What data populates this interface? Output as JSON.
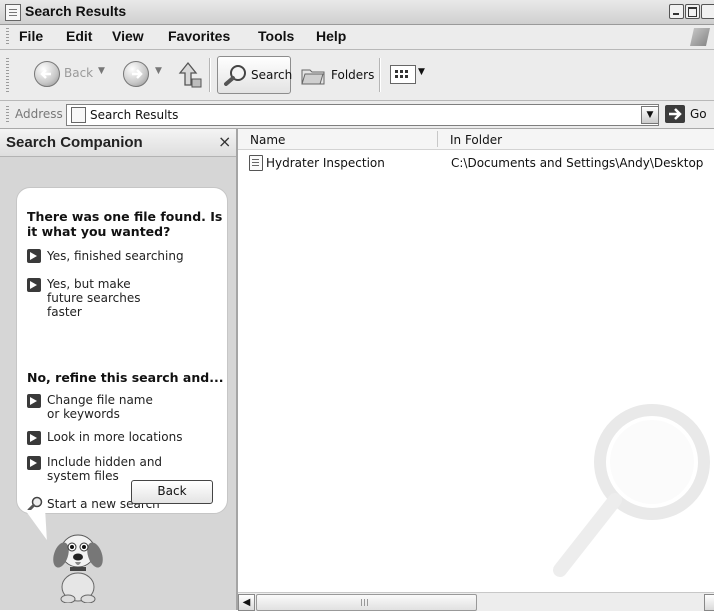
{
  "window": {
    "title": "Search Results"
  },
  "menu": {
    "items": [
      "File",
      "Edit",
      "View",
      "Favorites",
      "Tools",
      "Help"
    ]
  },
  "toolbar": {
    "back_label": "Back",
    "search_label": "Search",
    "folders_label": "Folders"
  },
  "address": {
    "label": "Address",
    "value": "Search Results",
    "go_label": "Go"
  },
  "companion": {
    "title": "Search Companion",
    "close_glyph": "×",
    "question": "There was one file found. Is it what you wanted?",
    "options": [
      "Yes, finished searching",
      "Yes, but make future searches faster"
    ],
    "refine_heading": "No, refine this search and...",
    "refine_options": [
      "Change file name or keywords",
      "Look in more locations",
      "Include hidden and system files"
    ],
    "new_search": "Start a new search",
    "back_button": "Back"
  },
  "results": {
    "columns": [
      "Name",
      "In Folder"
    ],
    "rows": [
      {
        "name": "Hydrater Inspection",
        "folder": "C:\\Documents and Settings\\Andy\\Desktop"
      }
    ]
  },
  "icons": [
    "search-results-icon",
    "back-arrow-icon",
    "forward-arrow-icon",
    "up-folder-icon",
    "search-icon",
    "folders-icon",
    "views-icon",
    "go-arrow-icon",
    "windows-logo-icon",
    "document-icon",
    "magnifier-icon",
    "dog-icon"
  ]
}
